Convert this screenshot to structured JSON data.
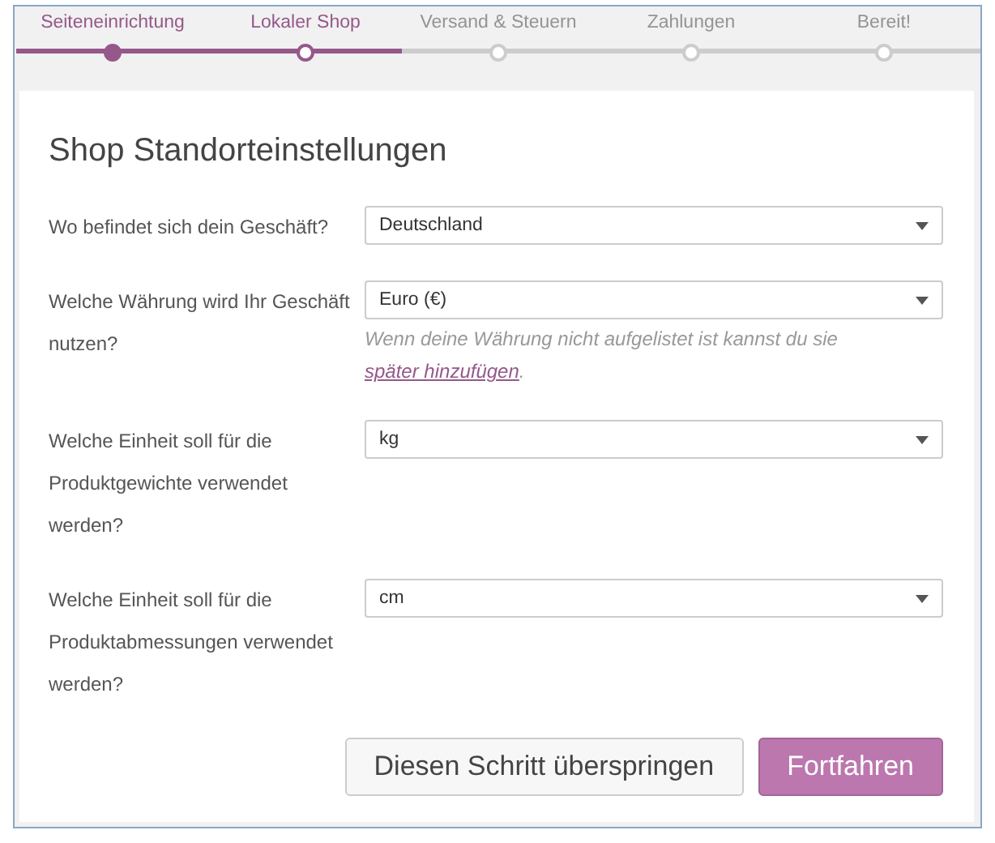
{
  "steps": [
    {
      "label": "Seiteneinrichtung",
      "done": true,
      "current": false
    },
    {
      "label": "Lokaler Shop",
      "done": false,
      "current": true
    },
    {
      "label": "Versand & Steuern",
      "done": false,
      "current": false
    },
    {
      "label": "Zahlungen",
      "done": false,
      "current": false
    },
    {
      "label": "Bereit!",
      "done": false,
      "current": false
    }
  ],
  "title": "Shop Standorteinstellungen",
  "fields": [
    {
      "label": "Wo befindet sich dein Geschäft?",
      "value": "Deutschland"
    },
    {
      "label": "Welche Währung wird Ihr Geschäft nutzen?",
      "value": "Euro (€)",
      "hint": "Wenn deine Währung nicht aufgelistet ist kannst du sie",
      "hint_link": "später hinzufügen",
      "hint_end": "."
    },
    {
      "label": "Welche Einheit soll für die Produktgewichte verwendet werden?",
      "value": "kg"
    },
    {
      "label": "Welche Einheit soll für die Produktabmessungen verwendet werden?",
      "value": "cm"
    }
  ],
  "buttons": {
    "skip": "Diesen Schritt überspringen",
    "continue": "Fortfahren"
  }
}
